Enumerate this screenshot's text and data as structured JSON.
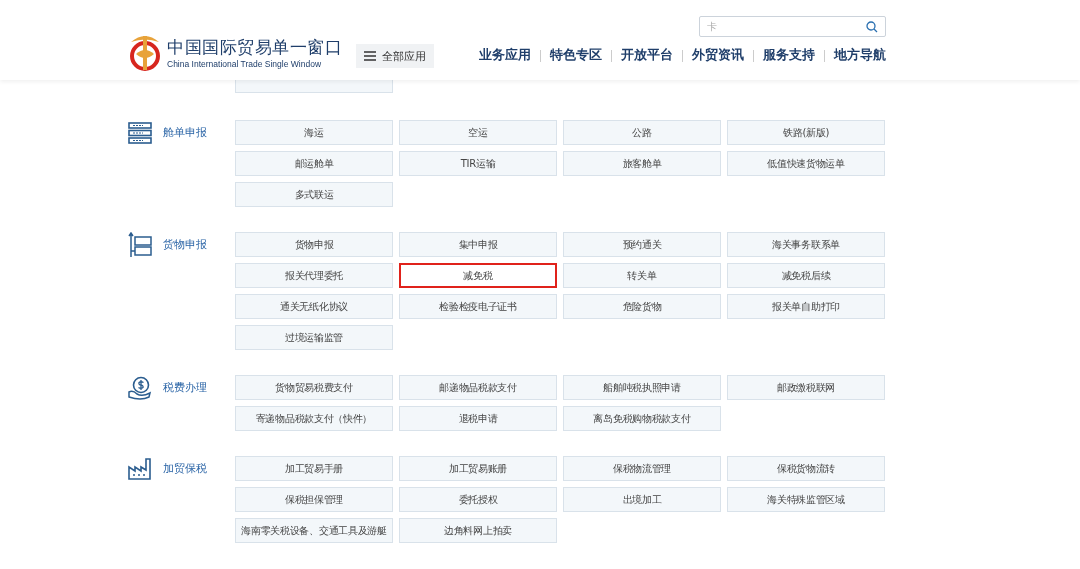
{
  "header": {
    "logo_title": "中国国际贸易单一窗口",
    "logo_subtitle": "China International Trade Single Window",
    "all_apps_button": "全部应用",
    "search": {
      "value": "卡"
    },
    "nav": [
      "业务应用",
      "特色专区",
      "开放平台",
      "外贸资讯",
      "服务支持",
      "地方导航"
    ]
  },
  "sections": [
    {
      "kind": "manifest",
      "label": "舱单申报",
      "tiles": [
        {
          "label": "海运",
          "highlighted": false
        },
        {
          "label": "空运",
          "highlighted": false
        },
        {
          "label": "公路",
          "highlighted": false
        },
        {
          "label": "铁路(新版)",
          "highlighted": false
        },
        {
          "label": "邮运舱单",
          "highlighted": false
        },
        {
          "label": "TIR运输",
          "highlighted": false
        },
        {
          "label": "旅客舱单",
          "highlighted": false
        },
        {
          "label": "低值快速货物运单",
          "highlighted": false
        },
        {
          "label": "多式联运",
          "highlighted": false
        }
      ]
    },
    {
      "kind": "cargo",
      "label": "货物申报",
      "tiles": [
        {
          "label": "货物申报",
          "highlighted": false
        },
        {
          "label": "集中申报",
          "highlighted": false
        },
        {
          "label": "预约通关",
          "highlighted": false
        },
        {
          "label": "海关事务联系单",
          "highlighted": false
        },
        {
          "label": "报关代理委托",
          "highlighted": false
        },
        {
          "label": "减免税",
          "highlighted": true
        },
        {
          "label": "转关单",
          "highlighted": false
        },
        {
          "label": "减免税后续",
          "highlighted": false
        },
        {
          "label": "通关无纸化协议",
          "highlighted": false
        },
        {
          "label": "检验检疫电子证书",
          "highlighted": false
        },
        {
          "label": "危险货物",
          "highlighted": false
        },
        {
          "label": "报关单自助打印",
          "highlighted": false
        },
        {
          "label": "过境运输监管",
          "highlighted": false
        }
      ]
    },
    {
      "kind": "tax",
      "label": "税费办理",
      "tiles": [
        {
          "label": "货物贸易税费支付",
          "highlighted": false
        },
        {
          "label": "邮递物品税款支付",
          "highlighted": false
        },
        {
          "label": "船舶吨税执照申请",
          "highlighted": false
        },
        {
          "label": "邮政缴税联网",
          "highlighted": false
        },
        {
          "label": "寄递物品税款支付（快件）",
          "highlighted": false
        },
        {
          "label": "退税申请",
          "highlighted": false
        },
        {
          "label": "离岛免税购物税款支付",
          "highlighted": false
        }
      ]
    },
    {
      "kind": "factory",
      "label": "加贸保税",
      "tiles": [
        {
          "label": "加工贸易手册",
          "highlighted": false
        },
        {
          "label": "加工贸易账册",
          "highlighted": false
        },
        {
          "label": "保税物流管理",
          "highlighted": false
        },
        {
          "label": "保税货物流转",
          "highlighted": false
        },
        {
          "label": "保税担保管理",
          "highlighted": false
        },
        {
          "label": "委托授权",
          "highlighted": false
        },
        {
          "label": "出境加工",
          "highlighted": false
        },
        {
          "label": "海关特殊监管区域",
          "highlighted": false
        },
        {
          "label": "海南零关税设备、交通工具及游艇",
          "highlighted": false
        },
        {
          "label": "边角料网上拍卖",
          "highlighted": false
        }
      ]
    }
  ]
}
